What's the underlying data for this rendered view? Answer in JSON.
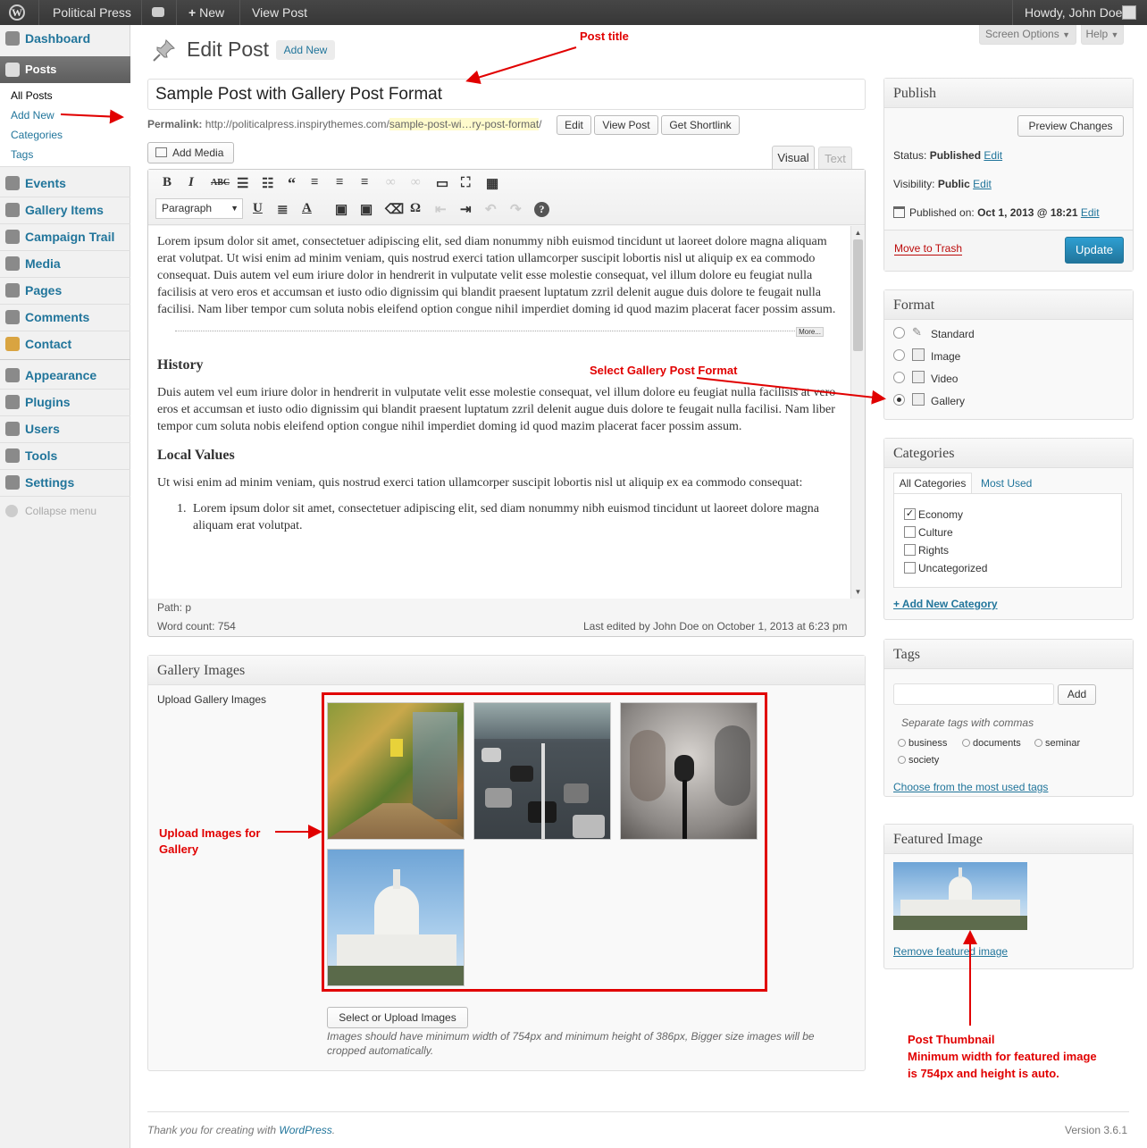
{
  "adminbar": {
    "site": "Political Press",
    "new": "New",
    "view_post": "View Post",
    "howdy": "Howdy, John Doe"
  },
  "sidebar": {
    "dashboard": "Dashboard",
    "posts": "Posts",
    "sub": [
      "All Posts",
      "Add New",
      "Categories",
      "Tags"
    ],
    "items": [
      "Events",
      "Gallery Items",
      "Campaign Trail",
      "Media",
      "Pages",
      "Comments",
      "Contact",
      "Appearance",
      "Plugins",
      "Users",
      "Tools",
      "Settings"
    ],
    "collapse": "Collapse menu"
  },
  "header": {
    "title": "Edit Post",
    "add_new": "Add New",
    "screen_options": "Screen Options",
    "help": "Help"
  },
  "post": {
    "title": "Sample Post with Gallery Post Format",
    "permalink_label": "Permalink:",
    "permalink_base": "http://politicalpress.inspirythemes.com/",
    "permalink_slug": "sample-post-wi…ry-post-format",
    "permalink_end": "/",
    "edit": "Edit",
    "view_post": "View Post",
    "get_shortlink": "Get Shortlink"
  },
  "editor": {
    "add_media": "Add Media",
    "visual": "Visual",
    "text": "Text",
    "format": "Paragraph",
    "p1": "Lorem ipsum dolor sit amet, consectetuer adipiscing elit, sed diam nonummy nibh euismod tincidunt ut laoreet dolore magna aliquam erat volutpat. Ut wisi enim ad minim veniam, quis nostrud exerci tation ullamcorper suscipit lobortis nisl ut aliquip ex ea commodo consequat. Duis autem vel eum iriure dolor in hendrerit in vulputate velit esse molestie consequat, vel illum dolore eu feugiat nulla facilisis at vero eros et accumsan et iusto odio dignissim qui blandit praesent luptatum zzril delenit augue duis dolore te feugait nulla facilisi. Nam liber tempor cum soluta nobis eleifend option congue nihil imperdiet doming id quod mazim placerat facer possim assum.",
    "more": "More...",
    "h1": "History",
    "p2": "Duis autem vel eum iriure dolor in hendrerit in vulputate velit esse molestie consequat, vel illum dolore eu feugiat nulla facilisis at vero eros et accumsan et iusto odio dignissim qui blandit praesent luptatum zzril delenit augue duis dolore te feugait nulla facilisi. Nam liber tempor cum soluta nobis eleifend option congue nihil imperdiet doming id quod mazim placerat facer possim assum.",
    "h2": "Local Values",
    "p3": "Ut wisi enim ad minim veniam, quis nostrud exerci tation ullamcorper suscipit lobortis nisl ut aliquip ex ea commodo consequat:",
    "li1": "Lorem ipsum dolor sit amet, consectetuer adipiscing elit, sed diam nonummy nibh euismod tincidunt ut laoreet dolore magna aliquam erat volutpat.",
    "path": "Path: p",
    "word_count": "Word count: 754",
    "last_edited": "Last edited by John Doe on October 1, 2013 at 6:23 pm"
  },
  "gallery": {
    "title": "Gallery Images",
    "label": "Upload Gallery Images",
    "button": "Select or Upload Images",
    "note": "Images should have minimum width of 754px and minimum height of 386px, Bigger size images will be cropped automatically."
  },
  "publish": {
    "title": "Publish",
    "preview": "Preview Changes",
    "status_label": "Status:",
    "status": "Published",
    "visibility_label": "Visibility:",
    "visibility": "Public",
    "published_label": "Published on:",
    "published": "Oct 1, 2013 @ 18:21",
    "edit": "Edit",
    "trash": "Move to Trash",
    "update": "Update"
  },
  "format": {
    "title": "Format",
    "options": [
      "Standard",
      "Image",
      "Video",
      "Gallery"
    ],
    "selected": "Gallery"
  },
  "categories": {
    "title": "Categories",
    "tab_all": "All Categories",
    "tab_used": "Most Used",
    "items": [
      "Economy",
      "Culture",
      "Rights",
      "Uncategorized"
    ],
    "checked": [
      "Economy"
    ],
    "add_new": "+ Add New Category"
  },
  "tags": {
    "title": "Tags",
    "add": "Add",
    "hint": "Separate tags with commas",
    "items": [
      "business",
      "documents",
      "seminar",
      "society"
    ],
    "choose": "Choose from the most used tags"
  },
  "featured": {
    "title": "Featured Image",
    "remove": "Remove featured image"
  },
  "annotations": {
    "post_title": "Post title",
    "add_new": "",
    "select_format": "Select Gallery Post Format",
    "upload_1": "Upload Images for",
    "upload_2": "Gallery",
    "thumb_1": "Post Thumbnail",
    "thumb_2": "Minimum width for featured image",
    "thumb_3": "is 754px and height is auto."
  },
  "footer": {
    "thanks": "Thank you for creating with ",
    "wp": "WordPress",
    "thanks_end": ".",
    "version": "Version 3.6.1"
  },
  "colors": {
    "link": "#21759b",
    "annotation": "#e10000",
    "update_button": "#2e8ec1"
  }
}
